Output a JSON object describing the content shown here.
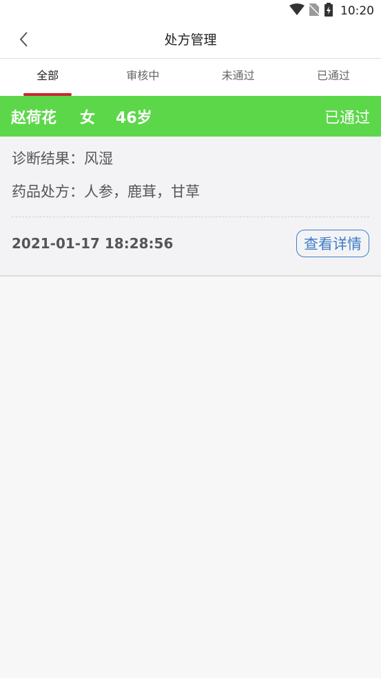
{
  "status_bar": {
    "time": "10:20"
  },
  "nav": {
    "title": "处方管理"
  },
  "tabs": [
    {
      "label": "全部",
      "active": true
    },
    {
      "label": "审核中",
      "active": false
    },
    {
      "label": "未通过",
      "active": false
    },
    {
      "label": "已通过",
      "active": false
    }
  ],
  "prescription": {
    "name": "赵荷花",
    "gender": "女",
    "age": "46岁",
    "status": "已通过",
    "diagnosis": "诊断结果：风湿",
    "medicines": "药品处方：人参，鹿茸，甘草",
    "timestamp": "2021-01-17 18:28:56",
    "detail_label": "查看详情"
  },
  "colors": {
    "header_green": "#5dd74a",
    "tab_indicator": "#c9262f",
    "link_blue": "#3f7cc8"
  }
}
